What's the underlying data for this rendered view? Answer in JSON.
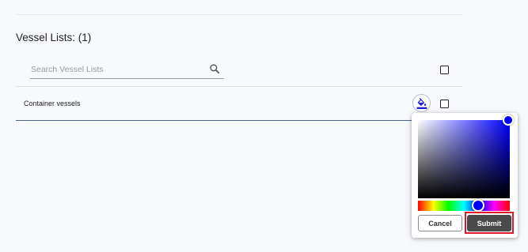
{
  "vessel_lists": {
    "heading": "Vessel Lists: (1)",
    "search": {
      "placeholder": "Search Vessel Lists",
      "value": ""
    },
    "select_all_checked": false,
    "items": [
      {
        "label": "Container vessels",
        "checked": false,
        "color": "#0000ff"
      }
    ]
  },
  "color_picker": {
    "selected_color": "#0000ff",
    "hue": 240,
    "cancel_label": "Cancel",
    "submit_label": "Submit"
  },
  "colors": {
    "accent": "#0000ff",
    "submit_bg": "#4a4a4a",
    "highlight": "#e2172b"
  },
  "icons": [
    "search-icon",
    "paint-bucket-icon",
    "checkbox-icon"
  ]
}
